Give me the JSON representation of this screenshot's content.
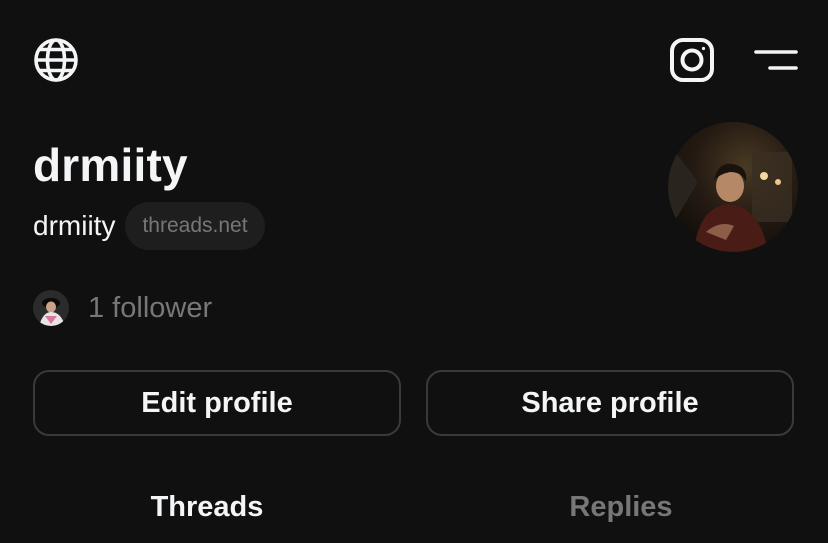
{
  "profile": {
    "display_name": "drmiity",
    "username": "drmiity",
    "domain_badge": "threads.net",
    "followers_text": "1 follower"
  },
  "icons": {
    "left": "globe-icon",
    "right": [
      "instagram-icon",
      "menu-icon"
    ]
  },
  "buttons": {
    "edit_profile": "Edit profile",
    "share_profile": "Share profile"
  },
  "tabs": [
    {
      "label": "Threads",
      "active": true
    },
    {
      "label": "Replies",
      "active": false
    }
  ],
  "colors": {
    "background": "#101010",
    "primary_text": "#f3f5f7",
    "secondary_text": "#777777",
    "button_border": "#3a3a3a",
    "pill_bg": "#1e1e1e"
  }
}
